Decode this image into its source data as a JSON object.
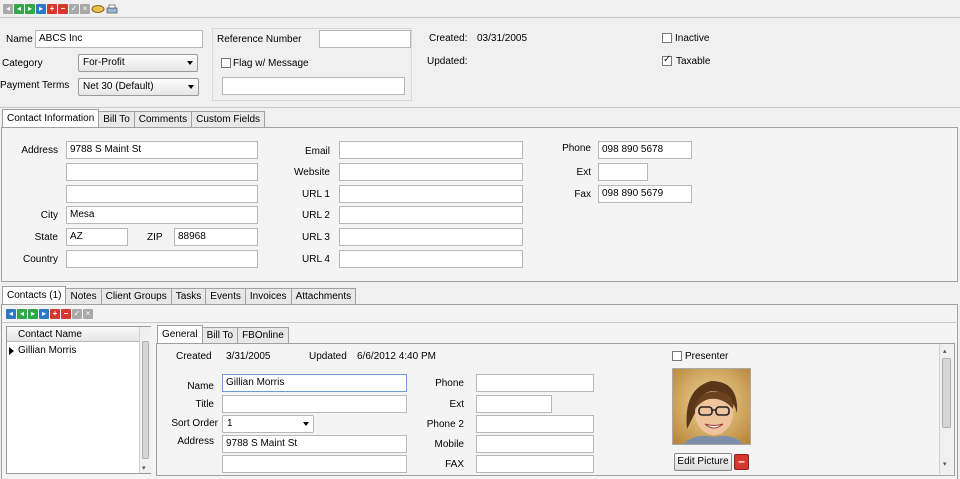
{
  "toolbar": {
    "icons": [
      "first-record-icon",
      "prev-record-icon",
      "next-record-icon",
      "last-record-icon",
      "add-record-icon",
      "delete-record-icon",
      "save-record-icon",
      "cancel-edit-icon",
      "find-icon",
      "print-icon"
    ]
  },
  "header": {
    "name_label": "Name",
    "name_value": "ABCS Inc",
    "category_label": "Category",
    "category_value": "For-Profit",
    "payment_terms_label": "Payment Terms",
    "payment_terms_value": "Net 30 (Default)",
    "reference_label": "Reference Number",
    "reference_value": "",
    "flag_label": "Flag w/ Message",
    "flag_message_value": "",
    "created_label": "Created:",
    "created_value": "03/31/2005",
    "updated_label": "Updated:",
    "updated_value": "",
    "inactive_label": "Inactive",
    "inactive_checked": false,
    "taxable_label": "Taxable",
    "taxable_checked": true
  },
  "main_tabs": [
    "Contact Information",
    "Bill To",
    "Comments",
    "Custom Fields"
  ],
  "contact_info": {
    "address_label": "Address",
    "address1": "9788 S Maint St",
    "address2": "",
    "address3": "",
    "city_label": "City",
    "city": "Mesa",
    "state_label": "State",
    "state": "AZ",
    "zip_label": "ZIP",
    "zip": "88968",
    "country_label": "Country",
    "country": "",
    "email_label": "Email",
    "email": "",
    "website_label": "Website",
    "website": "",
    "url1_label": "URL 1",
    "url1": "",
    "url2_label": "URL 2",
    "url2": "",
    "url3_label": "URL 3",
    "url3": "",
    "url4_label": "URL 4",
    "url4": "",
    "phone_label": "Phone",
    "phone": "098 890 5678",
    "ext_label": "Ext",
    "ext": "",
    "fax_label": "Fax",
    "fax": "098 890 5679"
  },
  "sub_tabs": [
    "Contacts (1)",
    "Notes",
    "Client Groups",
    "Tasks",
    "Events",
    "Invoices",
    "Attachments"
  ],
  "contacts_list": {
    "column_header": "Contact Name",
    "rows": [
      "Gillian Morris"
    ]
  },
  "contact_tabs": [
    "General",
    "Bill To",
    "FBOnline"
  ],
  "contact_detail": {
    "created_label": "Created",
    "created_value": "3/31/2005",
    "updated_label": "Updated",
    "updated_value": "6/6/2012 4:40 PM",
    "presenter_label": "Presenter",
    "presenter_checked": false,
    "name_label": "Name",
    "name_value": "Gillian Morris",
    "title_label": "Title",
    "title_value": "",
    "sort_order_label": "Sort Order",
    "sort_order_value": "1",
    "address_label": "Address",
    "address1": "9788 S Maint St",
    "address2": "",
    "phone_label": "Phone",
    "phone": "",
    "ext_label": "Ext",
    "ext": "",
    "phone2_label": "Phone 2",
    "phone2": "",
    "mobile_label": "Mobile",
    "mobile": "",
    "fax_label": "FAX",
    "fax": "",
    "edit_picture_label": "Edit Picture"
  }
}
